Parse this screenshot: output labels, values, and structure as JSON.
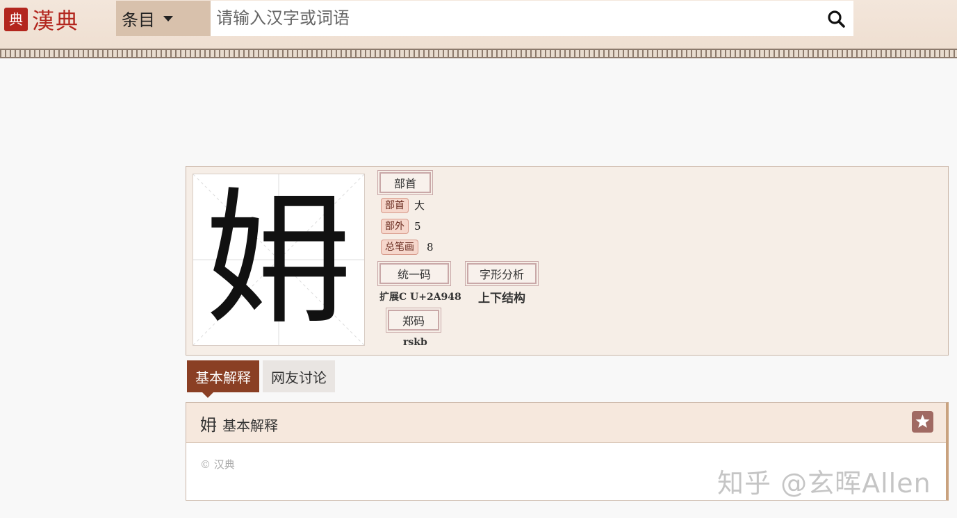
{
  "header": {
    "logo_seal": "典",
    "logo_text": "漢典",
    "scope_select": "条目",
    "search_placeholder": "请输入汉字或词语"
  },
  "char_card": {
    "character": "㚩",
    "radical_frame_label": "部首",
    "radical_label": "部首",
    "radical_value": "大",
    "outer_strokes_label": "部外",
    "outer_strokes_value": "5",
    "total_strokes_label": "总笔画",
    "total_strokes_value": "8",
    "unicode_frame_label": "统一码",
    "unicode_value": "扩展C U+2A948",
    "structure_frame_label": "字形分析",
    "structure_value": "上下结构",
    "zheng_frame_label": "郑码",
    "zheng_value": "rskb"
  },
  "tabs": [
    {
      "label": "基本解释",
      "active": true
    },
    {
      "label": "网友讨论",
      "active": false
    }
  ],
  "section": {
    "char": "㚩",
    "title": "基本解释",
    "copyright": "© 汉典",
    "favorite_icon": "star-icon"
  },
  "watermark": "知乎 @玄晖Allen",
  "colors": {
    "brand_red": "#b3261e",
    "tab_active": "#8a3f24",
    "header_bg": "#f3e6db"
  }
}
